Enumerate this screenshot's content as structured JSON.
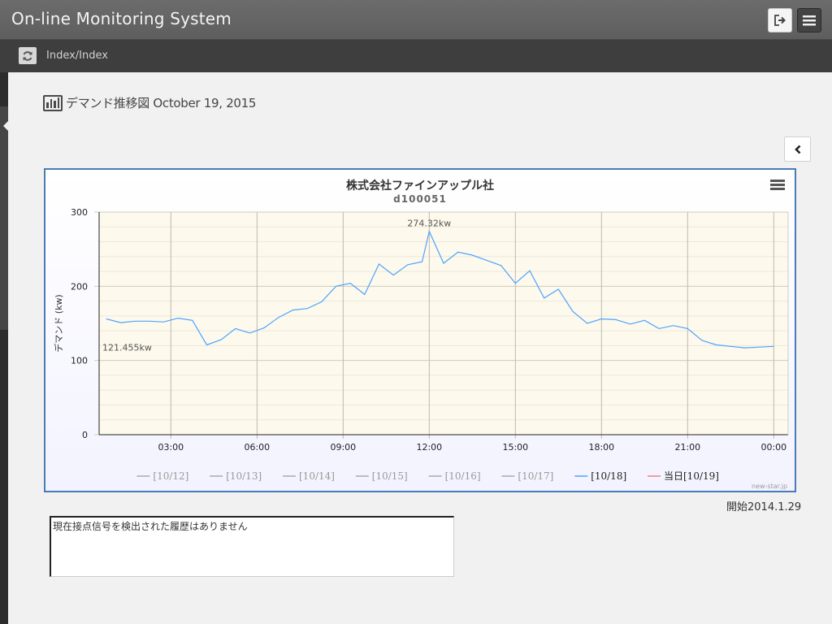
{
  "app": {
    "title": "On-line Monitoring System"
  },
  "header": {
    "logout_icon": "sign-out-icon",
    "menu_icon": "hamburger-icon"
  },
  "subbar": {
    "refresh_icon": "refresh-icon",
    "breadcrumb": "Index/Index"
  },
  "page": {
    "title": "デマンド推移図 October 19, 2015",
    "title_icon": "bar-chart-icon"
  },
  "chart_box": {
    "title": "株式会社ファインアップル社",
    "subtitle": "d100051",
    "credit": "new-star.jp"
  },
  "chart_data": {
    "type": "line",
    "title": "株式会社ファインアップル社",
    "subtitle": "d100051",
    "ylabel": "デマンド (kw)",
    "xlabel": "",
    "ylim": [
      0,
      300
    ],
    "yticks": [
      0,
      100,
      200,
      300
    ],
    "xlim": [
      0.5,
      24.5
    ],
    "xticks": [
      {
        "x": 3,
        "label": "03:00"
      },
      {
        "x": 6,
        "label": "06:00"
      },
      {
        "x": 9,
        "label": "09:00"
      },
      {
        "x": 12,
        "label": "12:00"
      },
      {
        "x": 15,
        "label": "15:00"
      },
      {
        "x": 18,
        "label": "18:00"
      },
      {
        "x": 21,
        "label": "21:00"
      },
      {
        "x": 24,
        "label": "00:00"
      }
    ],
    "grid": true,
    "legend_position": "bottom",
    "series": [
      {
        "name": "[10/12]",
        "color": "#aaaaaa",
        "visible": false
      },
      {
        "name": "[10/13]",
        "color": "#aaaaaa",
        "visible": false
      },
      {
        "name": "[10/14]",
        "color": "#aaaaaa",
        "visible": false
      },
      {
        "name": "[10/15]",
        "color": "#aaaaaa",
        "visible": false
      },
      {
        "name": "[10/16]",
        "color": "#aaaaaa",
        "visible": false
      },
      {
        "name": "[10/17]",
        "color": "#aaaaaa",
        "visible": false
      },
      {
        "name": "[10/18]",
        "color": "#4da3ff",
        "visible": true,
        "x": [
          0.75,
          1.25,
          1.75,
          2.25,
          2.75,
          3.25,
          3.75,
          4.25,
          4.75,
          5.25,
          5.75,
          6.25,
          6.75,
          7.25,
          7.75,
          8.25,
          8.75,
          9.25,
          9.75,
          10.25,
          10.75,
          11.25,
          11.75,
          12.0,
          12.5,
          13.0,
          13.5,
          14.0,
          14.5,
          15.0,
          15.5,
          16.0,
          16.5,
          17.0,
          17.5,
          18.0,
          18.5,
          19.0,
          19.5,
          20.0,
          20.5,
          21.0,
          21.5,
          22.0,
          22.5,
          23.0,
          23.5,
          24.0
        ],
        "y": [
          156,
          151,
          153,
          153,
          152,
          157,
          154,
          121,
          128,
          143,
          137,
          144,
          158,
          168,
          170,
          179,
          200,
          204,
          189,
          230,
          215,
          229,
          233,
          274,
          231,
          246,
          242,
          235,
          228,
          204,
          221,
          184,
          196,
          166,
          150,
          156,
          155,
          149,
          154,
          143,
          147,
          143,
          127,
          121,
          119,
          117,
          118,
          119
        ]
      },
      {
        "name": "当日[10/19]",
        "color": "#f08080",
        "visible": false
      }
    ],
    "annotations": [
      {
        "label": "274.32kw",
        "x": 12.0,
        "y": 274
      },
      {
        "label": "121.455kw",
        "x": 0.75,
        "y": 121
      }
    ]
  },
  "start": {
    "label": "開始2014.1.29"
  },
  "history": {
    "message": "現在接点信号を検出された履歴はありません"
  },
  "icons": {
    "collapse": "chevron-left-icon",
    "chart_menu": "chart-menu-icon"
  }
}
